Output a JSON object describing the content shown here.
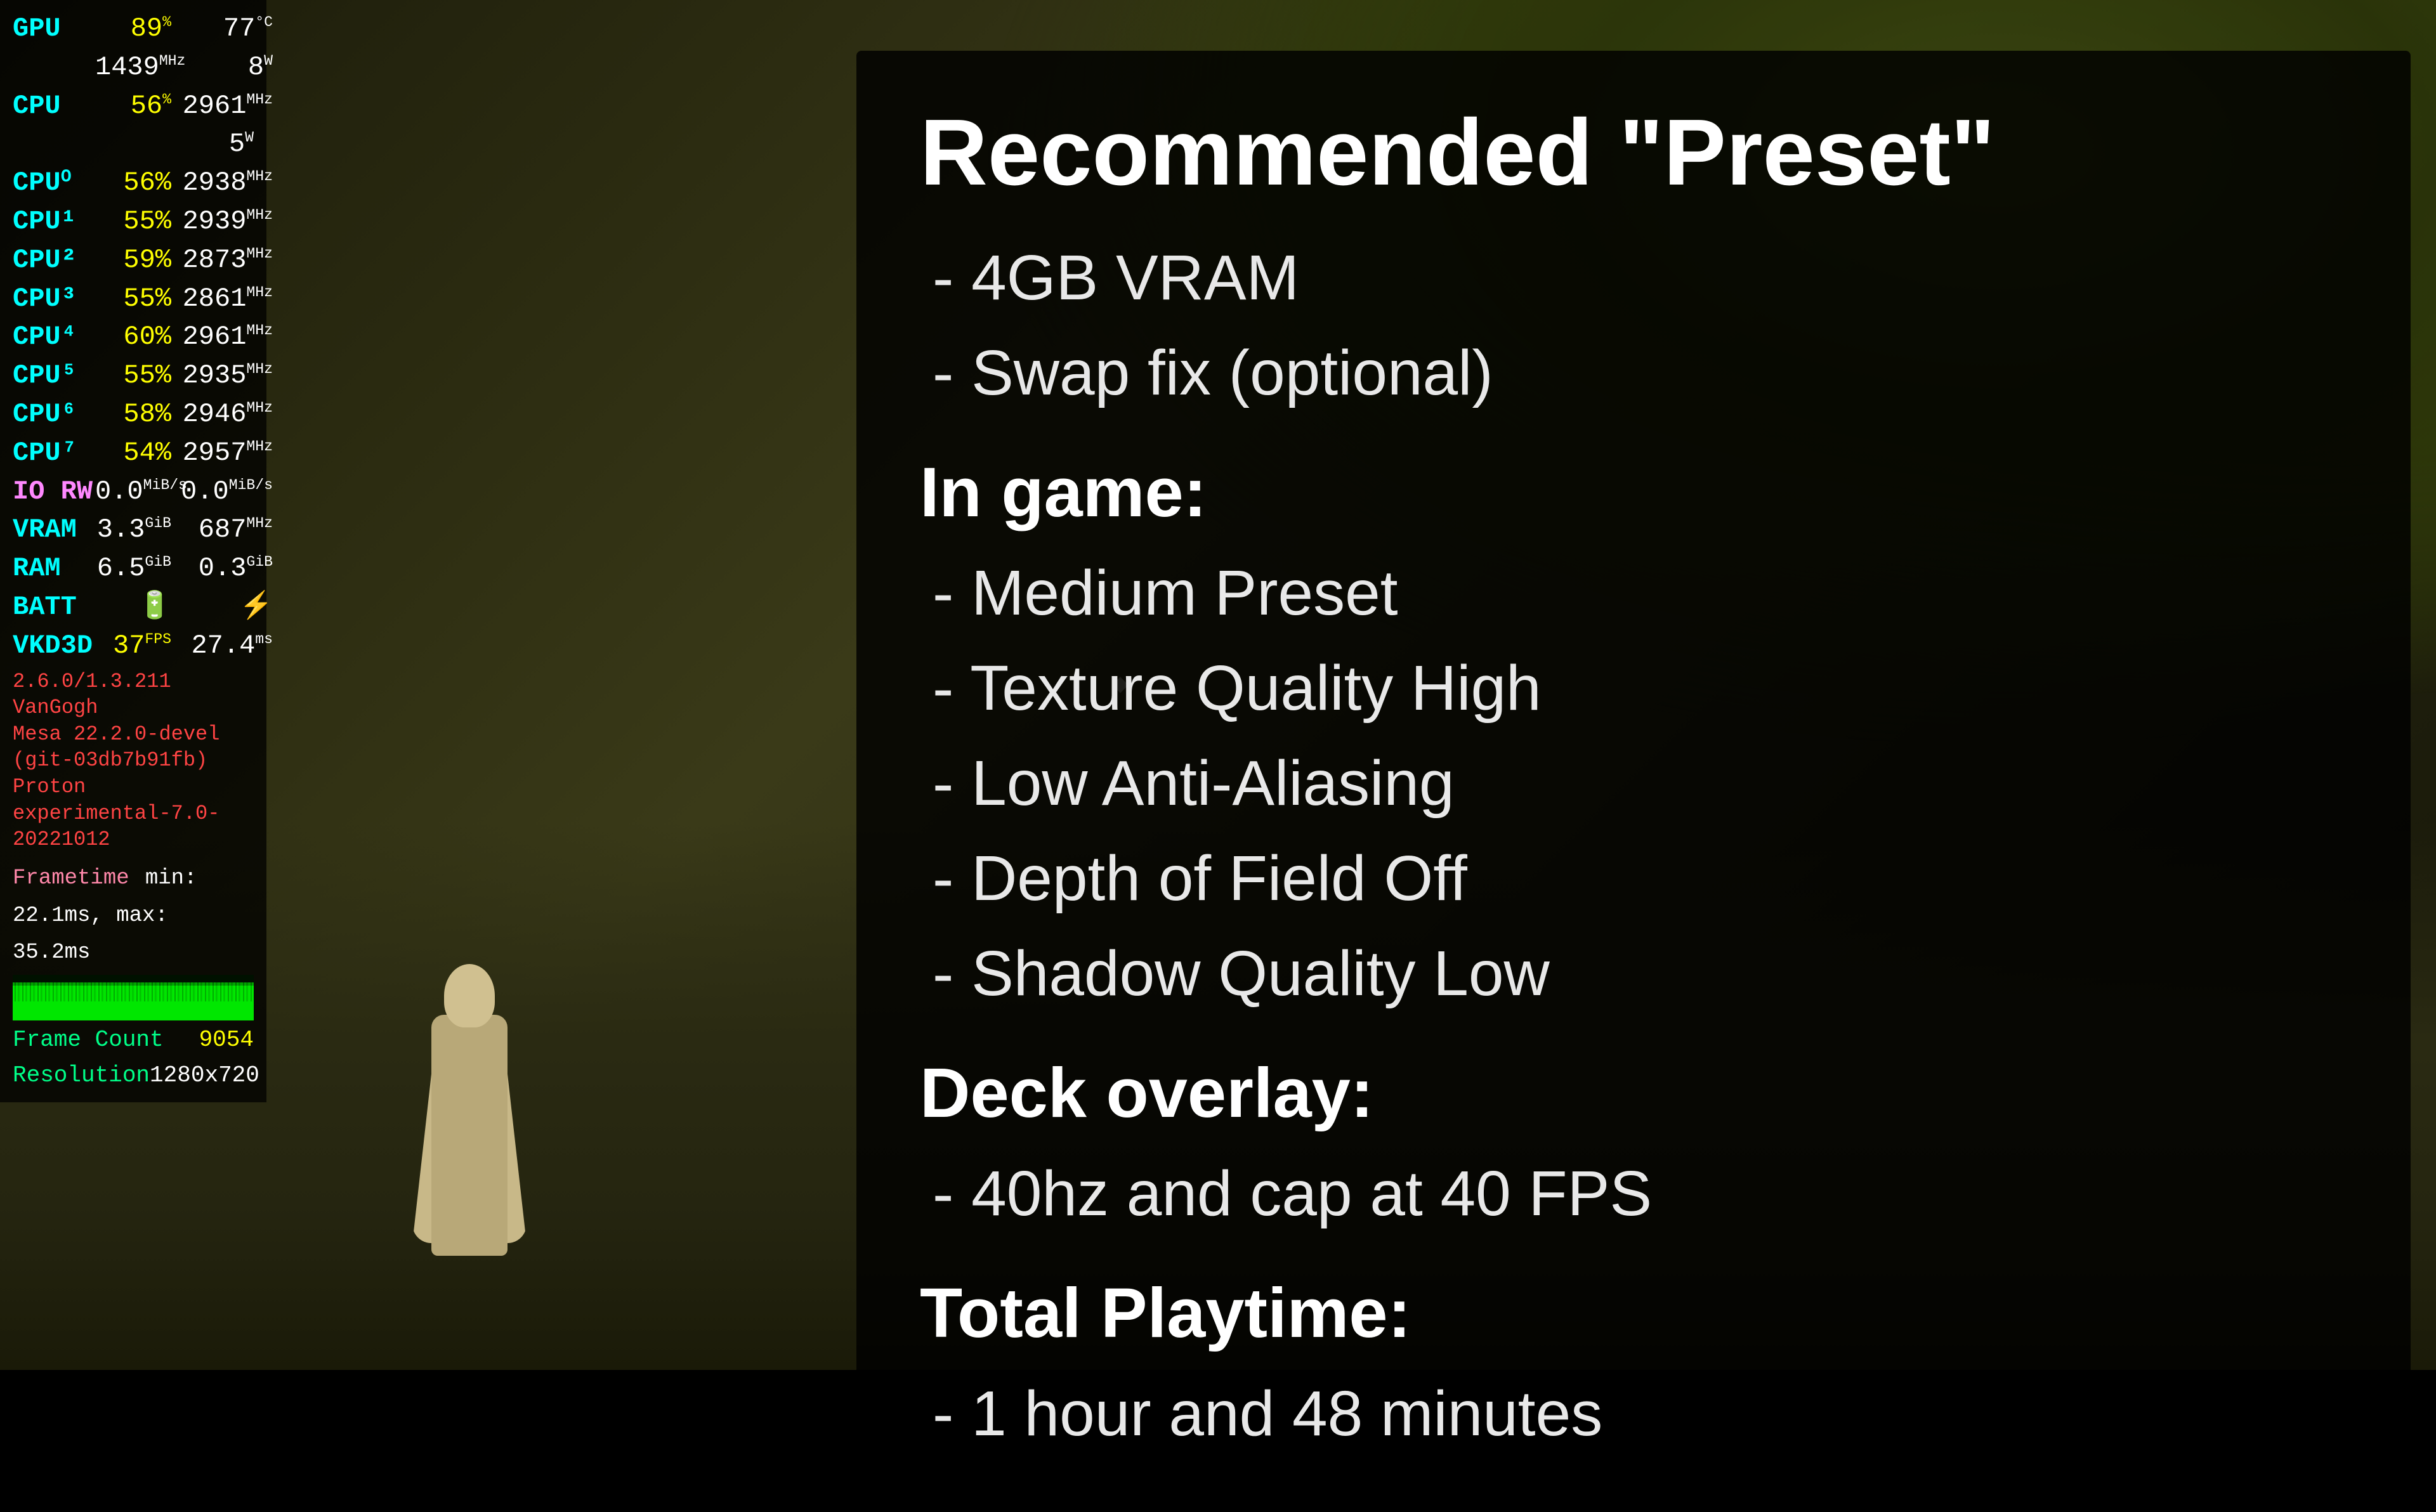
{
  "game": {
    "bg_desc": "dark forest game scene"
  },
  "hud": {
    "gpu_label": "GPU",
    "gpu_usage": "89",
    "gpu_usage_unit": "%",
    "gpu_temp": "77",
    "gpu_temp_unit": "°C",
    "gpu_clock": "1439",
    "gpu_clock_unit": "MHz",
    "gpu_power": "8",
    "gpu_power_unit": "W",
    "cpu_label": "CPU",
    "cpu_usage": "56",
    "cpu_usage_unit": "%",
    "cpu_clock": "2961",
    "cpu_clock_unit": "MHz",
    "cpu_power": "5",
    "cpu_power_unit": "W",
    "cpu_cores": [
      {
        "label": "CPU⁰",
        "usage": "56%",
        "clock": "2938",
        "clock_unit": "MHz"
      },
      {
        "label": "CPU¹",
        "usage": "55%",
        "clock": "2939",
        "clock_unit": "MHz"
      },
      {
        "label": "CPU²",
        "usage": "59%",
        "clock": "2873",
        "clock_unit": "MHz"
      },
      {
        "label": "CPU³",
        "usage": "55%",
        "clock": "2861",
        "clock_unit": "MHz"
      },
      {
        "label": "CPU⁴",
        "usage": "60%",
        "clock": "2961",
        "clock_unit": "MHz"
      },
      {
        "label": "CPU⁵",
        "usage": "55%",
        "clock": "2935",
        "clock_unit": "MHz"
      },
      {
        "label": "CPU⁶",
        "usage": "58%",
        "clock": "2946",
        "clock_unit": "MHz"
      },
      {
        "label": "CPU⁷",
        "usage": "54%",
        "clock": "2957",
        "clock_unit": "MHz"
      }
    ],
    "io_label": "IO RW",
    "io_read": "0.0",
    "io_read_unit": "MiB/s",
    "io_write": "0.0",
    "io_write_unit": "MiB/s",
    "vram_label": "VRAM",
    "vram_used": "3.3",
    "vram_used_unit": "GiB",
    "vram_clock": "687",
    "vram_clock_unit": "MHz",
    "ram_label": "RAM",
    "ram_used": "6.5",
    "ram_used_unit": "GiB",
    "ram_avail": "0.3",
    "ram_avail_unit": "GiB",
    "batt_label": "BATT",
    "vkd3d_label": "VKD3D",
    "fps": "37",
    "fps_unit": "FPS",
    "frametime": "27.4",
    "frametime_unit": "ms",
    "version_line1": "2.6.0/1.3.211",
    "version_line2": "VanGogh",
    "version_line3": "Mesa 22.2.0-devel (git-03db7b91fb)",
    "version_line4": "Proton experimental-7.0-20221012",
    "frametime_label": "Frametime",
    "frametime_min": "min: 22.1ms",
    "frametime_max": "max: 35.2ms",
    "frame_count_label": "Frame Count",
    "frame_count_val": "9054",
    "resolution_label": "Resolution",
    "resolution_val": "1280x720"
  },
  "panel": {
    "title": "Recommended \"Preset\"",
    "sections": [
      {
        "heading": "",
        "items": [
          "- 4GB VRAM",
          "- Swap fix (optional)"
        ]
      },
      {
        "heading": "In game:",
        "items": [
          "- Medium Preset",
          "- Texture Quality High",
          "- Low Anti-Aliasing",
          "- Depth of Field Off",
          "- Shadow Quality Low"
        ]
      },
      {
        "heading": "Deck overlay:",
        "items": [
          "- 40hz and cap at 40 FPS"
        ]
      },
      {
        "heading": "Total Playtime:",
        "items": [
          "- 1 hour and 48 minutes"
        ]
      }
    ]
  }
}
